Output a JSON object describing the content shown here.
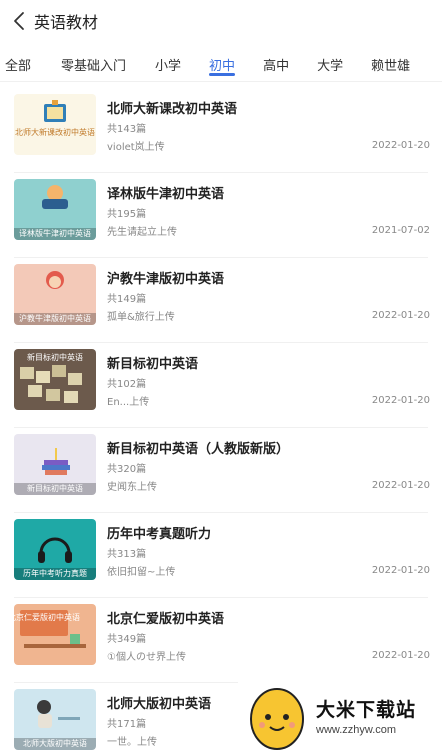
{
  "header": {
    "title": "英语教材"
  },
  "tabs": [
    {
      "label": "全部",
      "active": false
    },
    {
      "label": "零基础入门",
      "active": false
    },
    {
      "label": "小学",
      "active": false
    },
    {
      "label": "初中",
      "active": true
    },
    {
      "label": "高中",
      "active": false
    },
    {
      "label": "大学",
      "active": false
    },
    {
      "label": "赖世雄",
      "active": false
    }
  ],
  "items": [
    {
      "title": "北师大新课改初中英语",
      "count": "共143篇",
      "uploader": "violet岚上传",
      "date": "2022-01-20",
      "thumb_text": "北师大新课改初中英语",
      "thumb_bg": "#fbf6e6"
    },
    {
      "title": "译林版牛津初中英语",
      "count": "共195篇",
      "uploader": "先生请起立上传",
      "date": "2021-07-02",
      "thumb_text": "译林版牛津初中英语",
      "thumb_bg": "#8fd0cf"
    },
    {
      "title": "沪教牛津版初中英语",
      "count": "共149篇",
      "uploader": "孤单&旅行上传",
      "date": "2022-01-20",
      "thumb_text": "沪教牛津版初中英语",
      "thumb_bg": "#f3c9b8"
    },
    {
      "title": "新目标初中英语",
      "count": "共102篇",
      "uploader": "En...上传",
      "date": "2022-01-20",
      "thumb_text": "新目标初中英语",
      "thumb_bg": "#6c5a4c"
    },
    {
      "title": "新目标初中英语（人教版新版）",
      "count": "共320篇",
      "uploader": "史闻东上传",
      "date": "2022-01-20",
      "thumb_text": "新目标初中英语",
      "thumb_bg": "#e9e6f0"
    },
    {
      "title": "历年中考真题听力",
      "count": "共313篇",
      "uploader": "依旧扣留~上传",
      "date": "2022-01-20",
      "thumb_text": "历年中考听力真题",
      "thumb_bg": "#1fa9a6"
    },
    {
      "title": "北京仁爱版初中英语",
      "count": "共349篇",
      "uploader": "①個人のせ界上传",
      "date": "2022-01-20",
      "thumb_text": "北京仁爱版初中英语",
      "thumb_bg": "#f0b590"
    },
    {
      "title": "北师大版初中英语",
      "count": "共171篇",
      "uploader": "一世。上传",
      "date": "",
      "thumb_text": "北师大版初中英语",
      "thumb_bg": "#cfe6ef"
    }
  ],
  "watermark": {
    "title": "大米下载站",
    "url": "www.zzhyw.com"
  },
  "colors": {
    "accent": "#3a6fe0",
    "text_primary": "#222222",
    "text_secondary": "#888888"
  }
}
